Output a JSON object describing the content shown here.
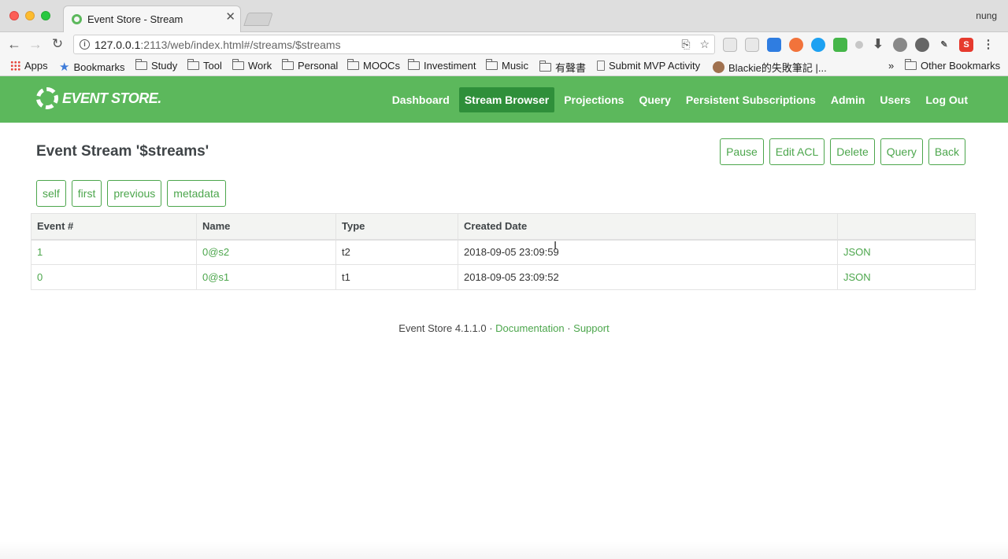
{
  "browser": {
    "tab_title": "Event Store - Stream",
    "tab_close": "✕",
    "profile": "nung",
    "url_host": "127.0.0.1",
    "url_rest": ":2113/web/index.html#/streams/$streams",
    "bookmarks": [
      {
        "label": "Apps",
        "icon": "apps-grid-icon"
      },
      {
        "label": "Bookmarks",
        "icon": "star-icon"
      },
      {
        "label": "Study",
        "icon": "folder-icon"
      },
      {
        "label": "Tool",
        "icon": "folder-icon"
      },
      {
        "label": "Work",
        "icon": "folder-icon"
      },
      {
        "label": "Personal",
        "icon": "folder-icon"
      },
      {
        "label": "MOOCs",
        "icon": "folder-icon"
      },
      {
        "label": "Investiment",
        "icon": "folder-icon"
      },
      {
        "label": "Music",
        "icon": "folder-icon"
      },
      {
        "label": "有聲書",
        "icon": "folder-icon"
      },
      {
        "label": "Submit MVP Activity",
        "icon": "page-icon"
      },
      {
        "label": "Blackie的失敗筆記 |...",
        "icon": "avatar-icon"
      }
    ],
    "bookmarks_overflow": "»",
    "other_bookmarks": "Other Bookmarks"
  },
  "header": {
    "logo_text": "EVENT STORE.",
    "nav": [
      "Dashboard",
      "Stream Browser",
      "Projections",
      "Query",
      "Persistent Subscriptions",
      "Admin",
      "Users",
      "Log Out"
    ],
    "active_nav": "Stream Browser"
  },
  "stream": {
    "title": "Event Stream '$streams'",
    "actions": [
      "Pause",
      "Edit ACL",
      "Delete",
      "Query",
      "Back"
    ],
    "links": [
      "self",
      "first",
      "previous",
      "metadata"
    ]
  },
  "table": {
    "columns": [
      "Event #",
      "Name",
      "Type",
      "Created Date",
      ""
    ],
    "rows": [
      {
        "event": "1",
        "name": "0@s2",
        "type": "t2",
        "created": "2018-09-05 23:09:59",
        "action": "JSON"
      },
      {
        "event": "0",
        "name": "0@s1",
        "type": "t1",
        "created": "2018-09-05 23:09:52",
        "action": "JSON"
      }
    ]
  },
  "footer": {
    "version": "Event Store 4.1.1.0",
    "sep1": " · ",
    "doc": "Documentation",
    "sep2": " · ",
    "support": "Support"
  },
  "colors": {
    "brand_green": "#5cb85c",
    "active_nav": "#2f8f3a",
    "link_green": "#4ca64c"
  }
}
